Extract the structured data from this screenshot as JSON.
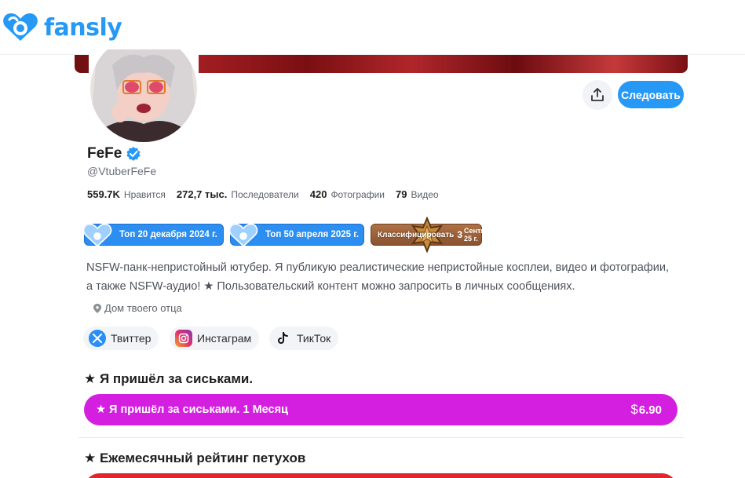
{
  "brand": {
    "logo_text": "fansly",
    "accent": "#2699f7"
  },
  "profile": {
    "name": "FeFe",
    "handle": "@VtuberFeFe",
    "verified_icon": "verified-check-icon",
    "follow_label": "Следовать",
    "share_icon": "share-upload-icon"
  },
  "stats": [
    {
      "value": "559.7K",
      "label": "Нравится"
    },
    {
      "value": "272,7 тыс.",
      "label": "Последователи"
    },
    {
      "value": "420",
      "label": "Фотографии"
    },
    {
      "value": "79",
      "label": "Видео"
    }
  ],
  "badges": [
    {
      "text": "Топ 20 декабря 2024 г.",
      "style": "blue"
    },
    {
      "text": "Топ 50 апреля 2025 г.",
      "style": "blue"
    },
    {
      "text": "Классифицировать",
      "rank": "3",
      "date_line1": "Сентя...",
      "date_line2": "25 г.",
      "style": "bronze"
    }
  ],
  "bio": {
    "line1": "NSFW-панк-непристойный ютубер. Я публикую реалистические непристойные косплеи, видео и фотографии,",
    "line2": "а также NSFW-аудио! ★ Пользовательский контент можно запросить в личных сообщениях."
  },
  "location": {
    "text": "Дом твоего отца",
    "icon": "location-pin-icon"
  },
  "socials": [
    {
      "label": "Твиттер",
      "icon": "x-twitter-icon"
    },
    {
      "label": "Инстаграм",
      "icon": "instagram-icon"
    },
    {
      "label": "ТикТок",
      "icon": "tiktok-icon"
    }
  ],
  "tiers": [
    {
      "title": "★ Я пришёл за сиськами.",
      "button_label": "★ Я пришёл за сиськами. 1 Месяц",
      "currency": "$",
      "price": "6.90",
      "color": "#d41ee0"
    },
    {
      "title": "★ Ежемесячный рейтинг петухов",
      "color": "#e0262e"
    }
  ]
}
